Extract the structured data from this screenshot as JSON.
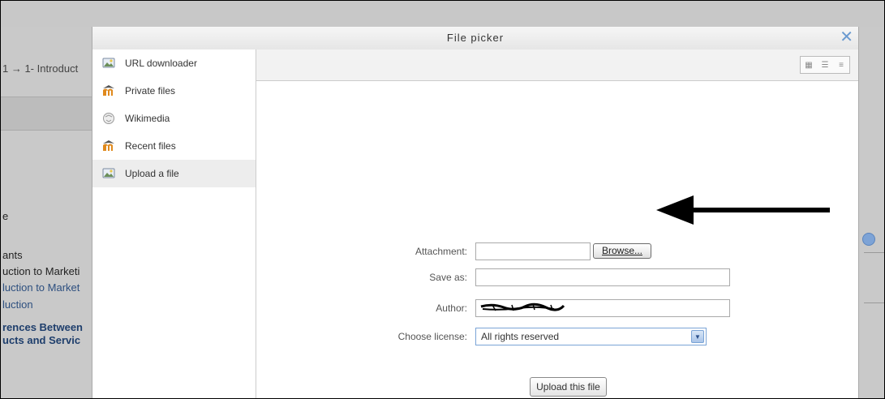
{
  "background": {
    "breadcrumb": "1 → 1- Introduct",
    "side_items": [
      {
        "text": "e",
        "style": "plain"
      },
      {
        "text": "ants",
        "style": "plain"
      },
      {
        "text": "uction to Marketi",
        "style": "plain"
      },
      {
        "text": "luction to Market",
        "style": "link"
      },
      {
        "text": "luction",
        "style": "link"
      },
      {
        "text": "rences Between",
        "style": "bold"
      },
      {
        "text": "ucts and Servic",
        "style": "bold"
      }
    ]
  },
  "modal": {
    "title": "File picker",
    "close_icon": "close-icon",
    "repositories": [
      {
        "label": "URL downloader",
        "icon": "url-downloader-icon"
      },
      {
        "label": "Private files",
        "icon": "moodle-icon"
      },
      {
        "label": "Wikimedia",
        "icon": "wikimedia-icon"
      },
      {
        "label": "Recent files",
        "icon": "moodle-icon"
      },
      {
        "label": "Upload a file",
        "icon": "upload-icon",
        "active": true
      }
    ],
    "form": {
      "attachment_label": "Attachment:",
      "attachment_value": "",
      "browse_label": "Browse...",
      "save_as_label": "Save as:",
      "save_as_value": "",
      "author_label": "Author:",
      "license_label": "Choose license:",
      "license_value": "All rights reserved",
      "upload_label": "Upload this file"
    }
  },
  "colors": {
    "accent": "#6a9ad0",
    "overlay": "#c9c9c9",
    "arrow": "#000000"
  }
}
